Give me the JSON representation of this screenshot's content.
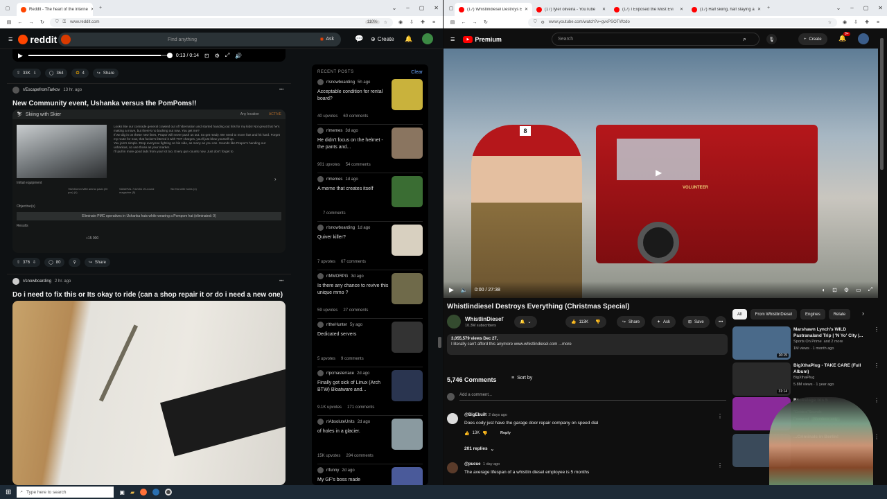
{
  "left": {
    "tab_title": "Reddit - The heart of the interne",
    "url": "www.reddit.com",
    "zoom": "110%",
    "search_placeholder": "Find anything",
    "ask": "Ask",
    "create": "Create",
    "video": {
      "time": "0:13 / 0:14",
      "progress": 0.93
    },
    "post0": {
      "upvotes": "33K",
      "comments": "364",
      "awards": "4",
      "share": "Share"
    },
    "post1": {
      "sub": "r/EscapefromTarkov",
      "age": "13 hr. ago",
      "title": "New Community event, Ushanka versus the PomPoms!!",
      "game": {
        "header": "Skiing with Skier",
        "loc": "Any location",
        "active": "ACTIVE",
        "desc": "Looks like our comrade general crawled out of hibernation and started handing out hits for my kids! Not great that he's making a move, but there's no backing out now. You get me?\nIf we dig in on these new lines, Prapor will never push us out. So get ready. We need to move fast and hit hard. Forget my route for now, that fucker's littered it with TNT charges, you'll just blow yourself up.\nYou join's simple. Drop everyone fighting on his side, as many as you can. Sounds like Prapor's handing out ushankas, so use those as your marker.\nI'll pull in more good lads from your lot too. Every gun counts now. Just don't forget to",
        "initial": "Initial equipment",
        "objectives": "Objective(s)",
        "objective": "Eliminate PMC operatives in Ushanka hats while wearing a Pompom hat (eliminated: 0)",
        "results": "Results",
        "exp": "+15 000",
        "items": [
          "762x51mm M80 ammo pack (20 pcs) (4)",
          "SA58/FAL 7.62x51 20-round magazine (5)",
          "Ski Hat with holes (4)"
        ]
      },
      "upvotes": "376",
      "comments": "80",
      "share": "Share"
    },
    "post2": {
      "sub": "r/snowboarding",
      "age": "2 hr. ago",
      "title": "Do i need to fix this or Its okay to ride (can a shop repair it or do i need a new one)"
    },
    "recent": {
      "heading": "RECENT POSTS",
      "clear": "Clear",
      "items": [
        {
          "sub": "r/snowboarding",
          "age": "5h ago",
          "title": "Acceptable condition for rental board?",
          "up": "40 upvotes",
          "cm": "60 comments"
        },
        {
          "sub": "r/memes",
          "age": "3d ago",
          "title": "He didn't focus on the helmet - the pants and...",
          "up": "901 upvotes",
          "cm": "54 comments"
        },
        {
          "sub": "r/memes",
          "age": "1d ago",
          "title": "A meme that creates itself",
          "up": "",
          "cm": "7 comments"
        },
        {
          "sub": "r/snowboarding",
          "age": "1d ago",
          "title": "Quiver killer?",
          "up": "7 upvotes",
          "cm": "67 comments"
        },
        {
          "sub": "r/MMORPG",
          "age": "3d ago",
          "title": "Is there any chance to revive this unique mmo ?",
          "up": "59 upvotes",
          "cm": "27 comments"
        },
        {
          "sub": "r/theHunter",
          "age": "5y ago",
          "title": "Dedicated servers",
          "up": "5 upvotes",
          "cm": "9 comments"
        },
        {
          "sub": "r/pcmasterrace",
          "age": "2d ago",
          "title": "Finally got sick of Linux (Arch BTW) Bloatware and...",
          "up": "9.1K upvotes",
          "cm": "171 comments"
        },
        {
          "sub": "r/AbsoluteUnits",
          "age": "2d ago",
          "title": "of holes in a glacier.",
          "up": "15K upvotes",
          "cm": "294 comments"
        },
        {
          "sub": "r/funny",
          "age": "2d ago",
          "title": "My GF's boss made",
          "up": "",
          "cm": ""
        }
      ]
    }
  },
  "right": {
    "tabs": [
      "(17) Whistlindiesel Destroys Ev",
      "(17) tyler oliveira - YouTube",
      "(17) I Exposed the Most Evi",
      "(17) Half skiing, half staying ali"
    ],
    "url": "www.youtube.com/watch?v=gvxPSOTWzdo",
    "brand": "Premium",
    "search_placeholder": "Search",
    "create": "Create",
    "notif": "9+",
    "player": {
      "time": "0:00 / 27:38",
      "badge": "8",
      "truck_text": "VOLUNTEER"
    },
    "title": "Whistlindiesel Destroys Everything (Christmas Special)",
    "channel": "WhistlinDiesel",
    "subs": "10.3M subscribers",
    "likes": "113K",
    "share": "Share",
    "ask": "Ask",
    "save": "Save",
    "desc_stats": "3,055,579 views  Dec 27,",
    "desc": "I literally can't afford this anymore www.whistlindiesel.com ...more",
    "comments_count": "5,746 Comments",
    "sort": "Sort by",
    "add_comment": "Add a comment...",
    "comments": [
      {
        "user": "@BigEbuilt",
        "age": "2 days ago",
        "text": "Does cody just have the garage door repair company on speed dial",
        "likes": "13K",
        "reply": "Reply",
        "replies": "201 replies"
      },
      {
        "user": "@pucue",
        "age": "1 day ago",
        "text": "The average lifespan of a whistlin diesel employee is 5 months"
      }
    ],
    "chips": [
      "All",
      "From WhistlinDiesel",
      "Engines",
      "Relate"
    ],
    "recs": [
      {
        "title": "Marshawn Lynch's WILD Pastranaland Trip | 'N Yo' City |...",
        "ch": "Sports On Prime",
        "extra": "and 2 more",
        "views": "1M views · 1 month ago",
        "dur": "16:15"
      },
      {
        "title": "BigXthaPlug - TAKE CARE (Full Album)",
        "ch": "BigXthaPlug",
        "views": "5.8M views · 1 year ago",
        "dur": "31:14"
      },
      {
        "title": "Backstage bts 5",
        "ch": "\"Celsius\"Sounds",
        "views": "Featured",
        "members": "Members only"
      },
      {
        "title": "...Criminals in Berlin!",
        "ch": "",
        "views": ""
      }
    ]
  },
  "taskbar": {
    "search_placeholder": "Type here to search"
  }
}
